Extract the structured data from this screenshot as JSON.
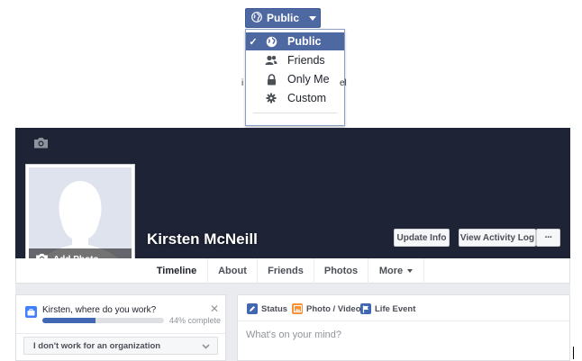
{
  "privacy": {
    "button_label": "Public",
    "menu": [
      {
        "label": "Public",
        "icon": "globe-icon",
        "selected": true
      },
      {
        "label": "Friends",
        "icon": "friends-icon",
        "selected": false
      },
      {
        "label": "Only Me",
        "icon": "lock-icon",
        "selected": false
      },
      {
        "label": "Custom",
        "icon": "gear-icon",
        "selected": false
      }
    ],
    "checkmark": "✓",
    "fragments": [
      "el",
      "i"
    ]
  },
  "profile": {
    "name": "Kirsten McNeill",
    "add_photo_label": "Add Photo",
    "cover_color": "#1e2436"
  },
  "cover_buttons": {
    "update_info": "Update Info",
    "activity_log": "View Activity Log",
    "more": "···"
  },
  "tabs": [
    {
      "label": "Timeline",
      "active": true
    },
    {
      "label": "About"
    },
    {
      "label": "Friends"
    },
    {
      "label": "Photos"
    },
    {
      "label": "More"
    }
  ],
  "work_prompt": {
    "question": "Kirsten, where do you work?",
    "progress_percent": 44,
    "progress_text": "44% complete",
    "close": "✕",
    "select_value": "I don't work for an organization"
  },
  "composer": {
    "tabs": [
      {
        "label": "Status",
        "icon": "pencil-icon",
        "color": "#4267b2"
      },
      {
        "label": "Photo / Video",
        "icon": "photo-icon",
        "color": "#f7923b"
      },
      {
        "label": "Life Event",
        "icon": "flag-icon",
        "color": "#4267b2"
      }
    ],
    "placeholder": "What's on your mind?"
  },
  "colors": {
    "accent": "#4e69a2",
    "brand": "#3b5998",
    "page_bg": "#e9ebee"
  }
}
